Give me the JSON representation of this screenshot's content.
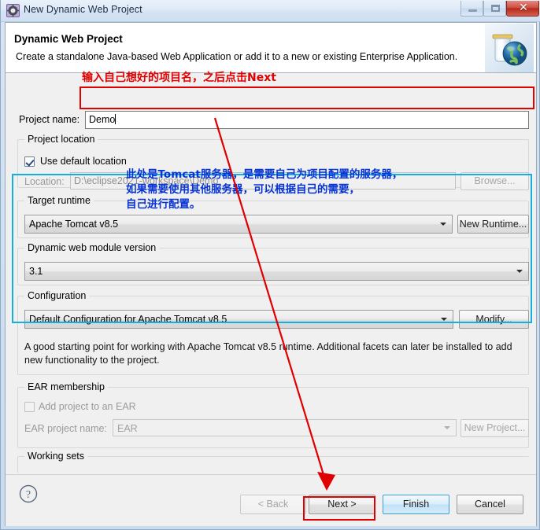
{
  "window": {
    "title": "New Dynamic Web Project",
    "icon": "eclipse-wizard-icon",
    "minimize_label": "",
    "maximize_label": "",
    "close_label": "✕"
  },
  "banner": {
    "title": "Dynamic Web Project",
    "description": "Create a standalone Java-based Web Application or add it to a new or existing Enterprise Application.",
    "icon": "jar-globe-icon"
  },
  "form": {
    "project_name_label": "Project name:",
    "project_name_value": "Demo",
    "project_location_group": "Project location",
    "use_default_location_label": "Use default location",
    "use_default_location_checked": true,
    "location_label": "Location:",
    "location_value": "D:\\eclipse2021-workspace\\Demo",
    "browse_button": "Browse...",
    "target_runtime_label": "Target runtime",
    "target_runtime_value": "Apache Tomcat v8.5",
    "new_runtime_button": "New Runtime...",
    "dynamic_web_module_label": "Dynamic web module version",
    "dynamic_web_module_value": "3.1",
    "configuration_label": "Configuration",
    "configuration_value": "Default Configuration for Apache Tomcat v8.5",
    "modify_button": "Modify...",
    "configuration_description": "A good starting point for working with Apache Tomcat v8.5 runtime. Additional facets can later be installed to add new functionality to the project.",
    "ear_membership_group": "EAR membership",
    "add_project_to_ear_label": "Add project to an EAR",
    "add_project_to_ear_checked": false,
    "ear_project_name_label": "EAR project name:",
    "ear_project_name_value": "EAR",
    "new_project_button": "New Project...",
    "working_sets_group": "Working sets"
  },
  "buttons": {
    "help": "?",
    "back": "< Back",
    "next": "Next >",
    "finish": "Finish",
    "cancel": "Cancel"
  },
  "annotations": {
    "red_note_project_name": "输入自己想好的项目名，之后点击Next",
    "blue_note_line1": "此处是Tomcat服务器，是需要自己为项目配置的服务器，",
    "blue_note_line2": "如果需要使用其他服务器，可以根据自己的需要，",
    "blue_note_line3": "自己进行配置。",
    "colors": {
      "red": "#e00000",
      "blue": "#0633d6",
      "cyan": "#14aee0"
    }
  }
}
